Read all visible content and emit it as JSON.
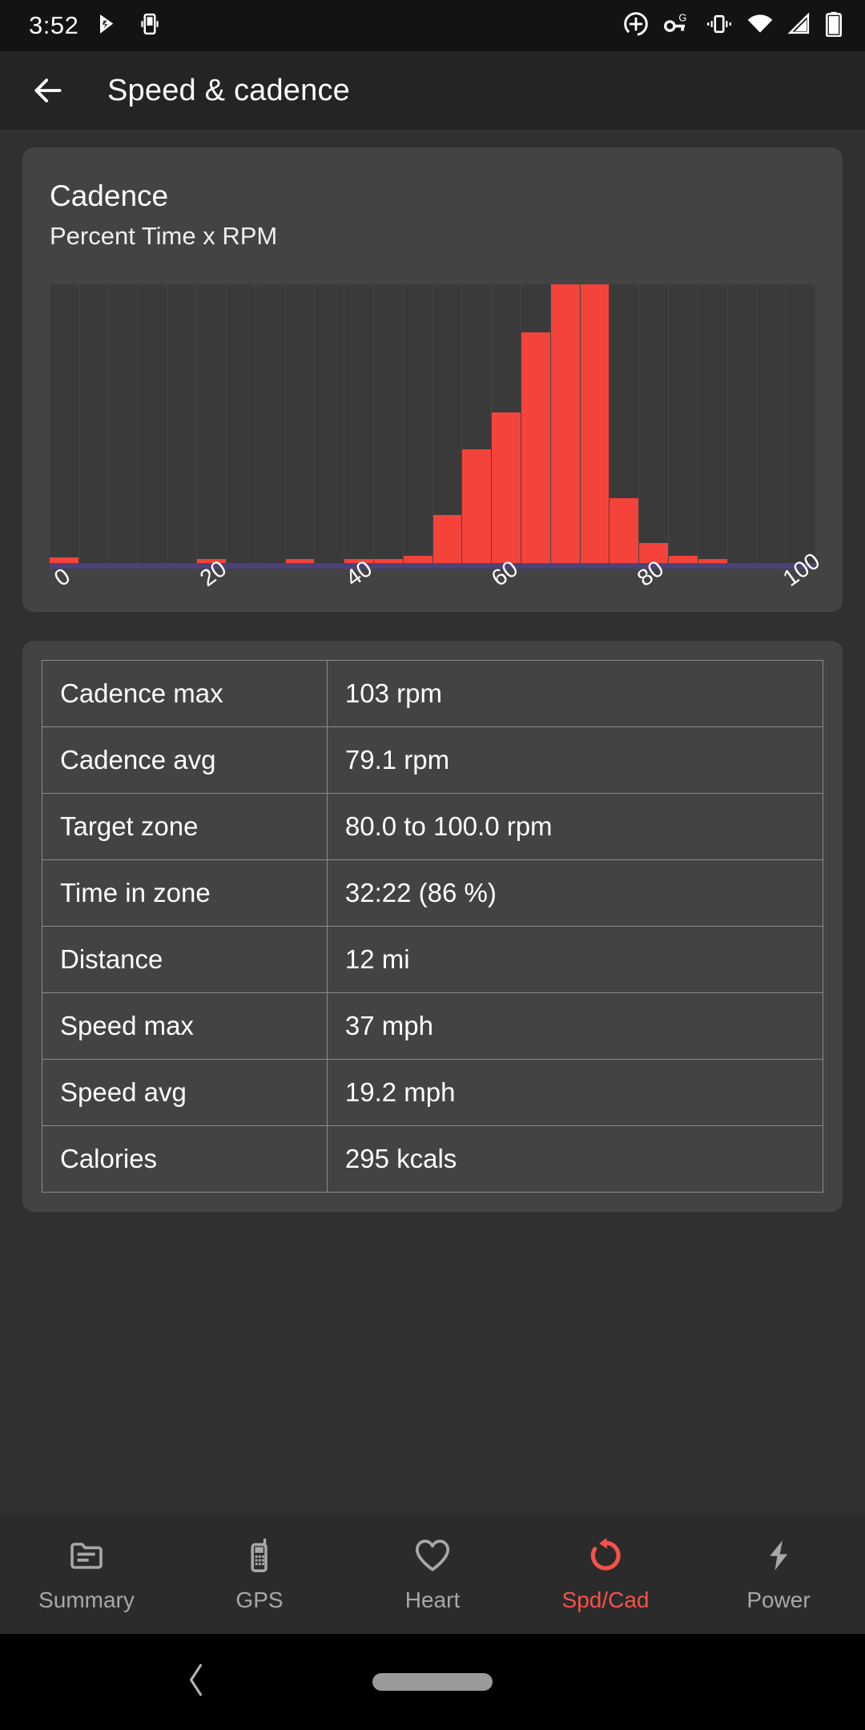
{
  "status_bar": {
    "time": "3:52",
    "left_icons": [
      "play-store-icon",
      "device-cast-icon"
    ],
    "right_icons": [
      "location-target-icon",
      "vpn-key-g-icon",
      "vibrate-icon",
      "wifi-icon",
      "cellular-signal-icon",
      "battery-icon"
    ]
  },
  "app_bar": {
    "back_icon": "back-arrow-icon",
    "title": "Speed & cadence"
  },
  "chart_card": {
    "title": "Cadence",
    "subtitle": "Percent Time x RPM"
  },
  "chart_data": {
    "type": "bar",
    "title": "Cadence",
    "subtitle": "Percent Time x RPM",
    "xlabel": "RPM",
    "ylabel": "Percent Time",
    "grid": false,
    "legend": "none",
    "bar_color": "#F4433A",
    "baseline_color": "#4b4277",
    "xlim": [
      0,
      105
    ],
    "ylim": [
      0,
      100
    ],
    "bin_width": 4,
    "tick_labels": [
      "0",
      "20",
      "40",
      "60",
      "80",
      "100"
    ],
    "tick_values": [
      0,
      20,
      40,
      60,
      80,
      100
    ],
    "tick_rotation_deg": -36,
    "categories": [
      0,
      4,
      8,
      12,
      16,
      20,
      24,
      28,
      32,
      36,
      40,
      44,
      48,
      52,
      56,
      60,
      64,
      68,
      72,
      76,
      80,
      84,
      88,
      92,
      96,
      100
    ],
    "values": [
      2.2,
      0,
      0,
      0,
      0,
      0.6,
      0,
      0,
      0.6,
      0,
      0.7,
      1.3,
      2.6,
      16.7,
      39.5,
      52.2,
      80.0,
      96.5,
      96.5,
      22.5,
      7.0,
      2.6,
      1.0,
      0,
      0,
      0
    ]
  },
  "stats_table": {
    "rows": [
      {
        "key": "Cadence max",
        "value": "103 rpm"
      },
      {
        "key": "Cadence avg",
        "value": "79.1 rpm"
      },
      {
        "key": "Target zone",
        "value": "80.0 to 100.0 rpm"
      },
      {
        "key": "Time in zone",
        "value": "32:22 (86 %)"
      },
      {
        "key": "Distance",
        "value": "12 mi"
      },
      {
        "key": "Speed max",
        "value": "37 mph"
      },
      {
        "key": "Speed avg",
        "value": "19.2 mph"
      },
      {
        "key": "Calories",
        "value": "295 kcals"
      }
    ]
  },
  "bottom_nav": {
    "active_color": "#F4534A",
    "inactive_color": "#a8a8a8",
    "items": [
      {
        "label": "Summary",
        "icon": "summary-file-icon",
        "active": false
      },
      {
        "label": "GPS",
        "icon": "mobile-phone-icon",
        "active": false
      },
      {
        "label": "Heart",
        "icon": "heart-icon",
        "active": false
      },
      {
        "label": "Spd/Cad",
        "icon": "rotate-refresh-icon",
        "active": true
      },
      {
        "label": "Power",
        "icon": "lightning-bolt-icon",
        "active": false
      }
    ]
  },
  "system_nav": {
    "back_icon": "system-back-icon",
    "home_pill": "home-indicator-pill"
  }
}
